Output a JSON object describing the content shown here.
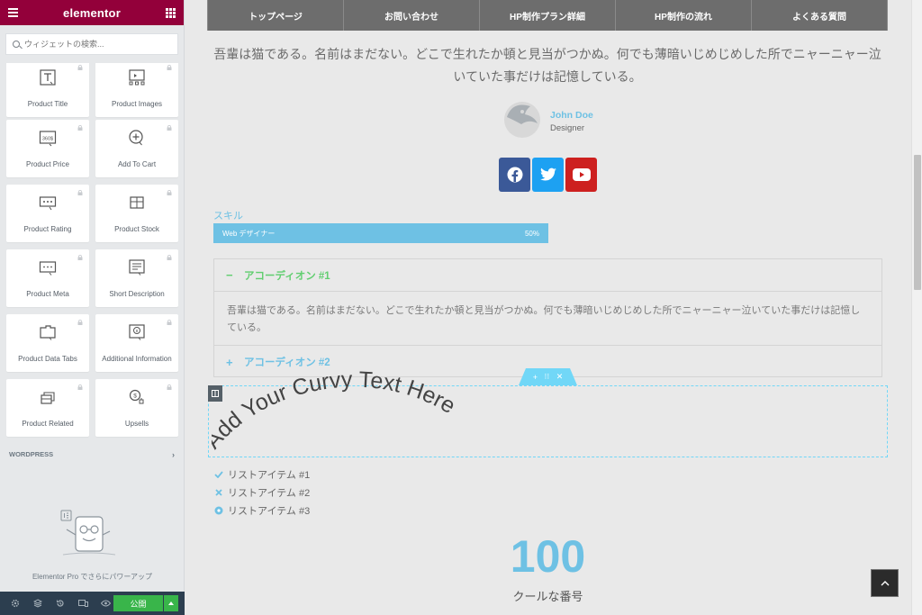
{
  "editor": {
    "logo": "elementor",
    "search_placeholder": "ウィジェットの検索...",
    "widgets": [
      {
        "label": "Product Title",
        "icon": "product-title-icon"
      },
      {
        "label": "Product Images",
        "icon": "product-images-icon"
      },
      {
        "label": "Product Price",
        "icon": "product-price-icon"
      },
      {
        "label": "Add To Cart",
        "icon": "add-to-cart-icon"
      },
      {
        "label": "Product Rating",
        "icon": "product-rating-icon"
      },
      {
        "label": "Product Stock",
        "icon": "product-stock-icon"
      },
      {
        "label": "Product Meta",
        "icon": "product-meta-icon"
      },
      {
        "label": "Short Description",
        "icon": "short-description-icon"
      },
      {
        "label": "Product Data Tabs",
        "icon": "product-data-tabs-icon"
      },
      {
        "label": "Additional Information",
        "icon": "additional-information-icon"
      },
      {
        "label": "Product Related",
        "icon": "product-related-icon"
      },
      {
        "label": "Upsells",
        "icon": "upsells-icon"
      }
    ],
    "price_icon_text": "360$",
    "category_label": "WORDPRESS",
    "promo_text": "Elementor Pro でさらにパワーアップ",
    "publish_label": "公開"
  },
  "nav": {
    "items": [
      "トップページ",
      "お問い合わせ",
      "HP制作プラン詳細",
      "HP制作の流れ",
      "よくある質問"
    ]
  },
  "intro_text": "吾輩は猫である。名前はまだない。どこで生れたか頓と見当がつかぬ。何でも薄暗いじめじめした所でニャーニャー泣いていた事だけは記憶している。",
  "author": {
    "name": "John Doe",
    "title": "Designer"
  },
  "social": [
    {
      "network": "facebook",
      "icon": "facebook-icon",
      "color": "#3b5998"
    },
    {
      "network": "twitter",
      "icon": "twitter-icon",
      "color": "#1da1f2"
    },
    {
      "network": "youtube",
      "icon": "youtube-icon",
      "color": "#cd201f"
    }
  ],
  "skill": {
    "title": "スキル",
    "bar_label": "Web デザイナー",
    "percent_text": "50%",
    "percent": 50
  },
  "accordion": [
    {
      "title": "アコーディオン #1",
      "content": "吾輩は猫である。名前はまだない。どこで生れたか頓と見当がつかぬ。何でも薄暗いじめじめした所でニャーニャー泣いていた事だけは記憶している。",
      "expanded": true,
      "icon": "minus-icon"
    },
    {
      "title": "アコーディオン #2",
      "content": "",
      "expanded": false,
      "icon": "plus-icon"
    }
  ],
  "curvy_text": "Add Your Curvy Text Here",
  "list": [
    {
      "text": "リストアイテム #1",
      "icon": "check-icon"
    },
    {
      "text": "リストアイテム #2",
      "icon": "times-icon"
    },
    {
      "text": "リストアイテム #3",
      "icon": "dot-circle-icon"
    }
  ],
  "counter": {
    "number": "100",
    "title": "クールな番号"
  },
  "colors": {
    "brand": "#93003a",
    "accent": "#6ec1e4",
    "success": "#61ce70",
    "publish": "#39b54a",
    "footer": "#2c3e4f"
  }
}
